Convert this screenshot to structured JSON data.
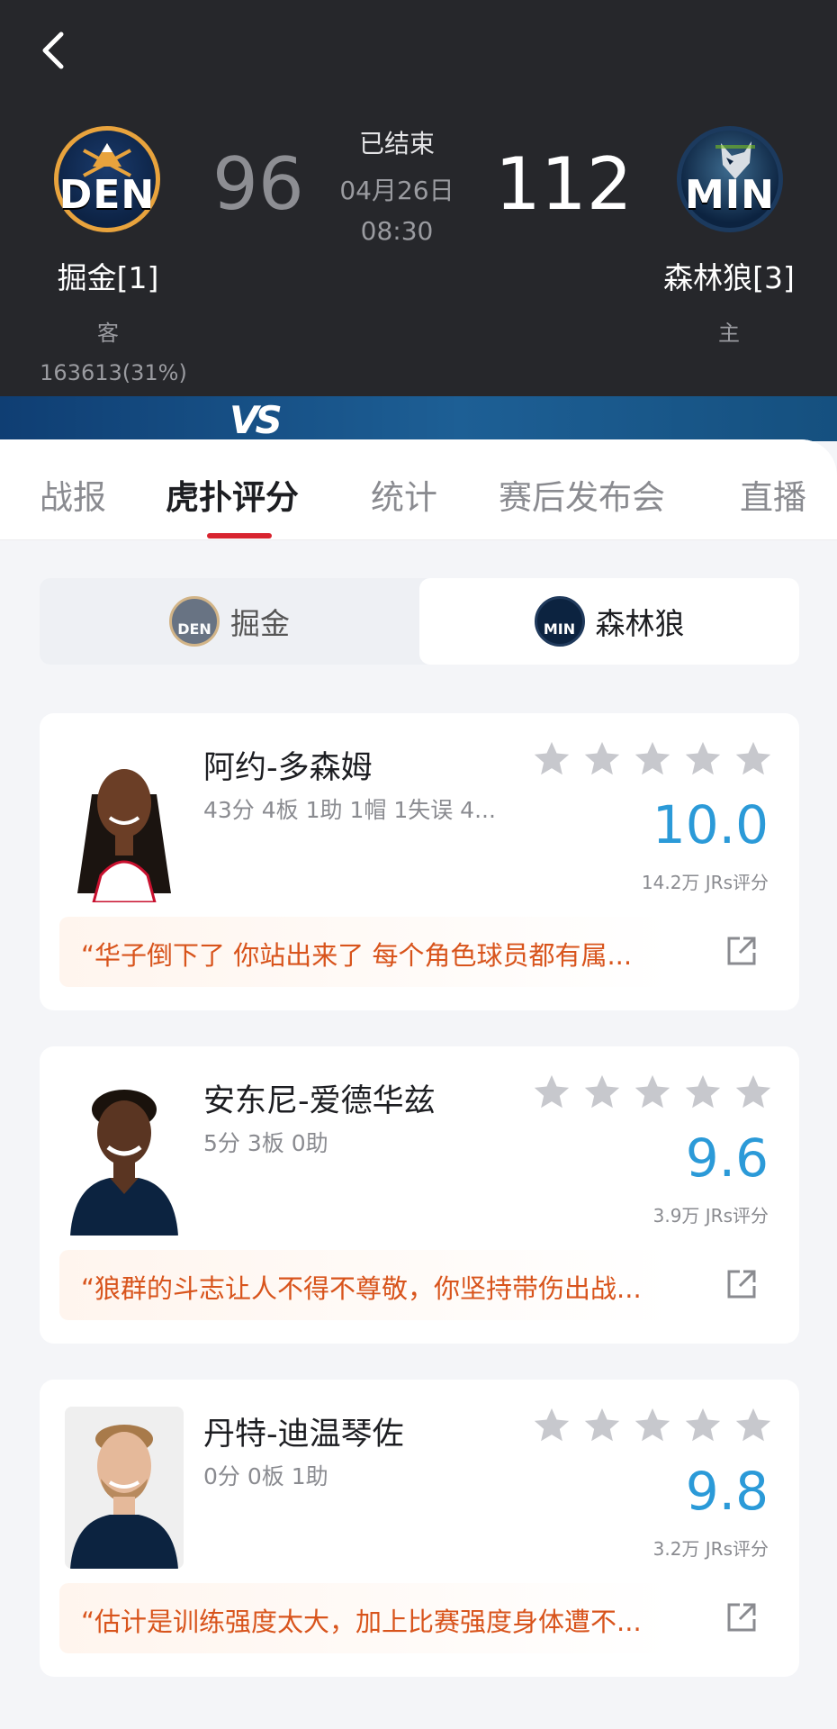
{
  "header": {
    "away": {
      "abbr": "DEN",
      "name": "掘金[1]",
      "role": "客",
      "support": "163613(31%)",
      "score": "96"
    },
    "home": {
      "abbr": "MIN",
      "name": "森林狼[3]",
      "role": "主",
      "score": "112"
    },
    "status": "已结束",
    "date": "04月26日",
    "time": "08:30",
    "vs_label": "VS",
    "icons": {
      "back": "chevron-left-icon"
    }
  },
  "tabs": [
    {
      "label": "战报",
      "active": false
    },
    {
      "label": "虎扑评分",
      "active": true
    },
    {
      "label": "统计",
      "active": false
    },
    {
      "label": "赛后发布会",
      "active": false
    },
    {
      "label": "直播",
      "active": false
    }
  ],
  "team_switch": {
    "left": {
      "abbr": "DEN",
      "label": "掘金",
      "selected": false
    },
    "right": {
      "abbr": "MIN",
      "label": "森林狼",
      "selected": true
    }
  },
  "players": [
    {
      "name": "阿约-多森姆",
      "stats": "43分 4板 1助 1帽 1失误 4...",
      "rating": "10.0",
      "votes": "14.2万 JRs评分",
      "stars": 5,
      "quote": "“华子倒下了 你站出来了 每个角色球员都有属..."
    },
    {
      "name": "安东尼-爱德华兹",
      "stats": "5分 3板 0助",
      "rating": "9.6",
      "votes": "3.9万 JRs评分",
      "stars": 5,
      "quote": "“狼群的斗志让人不得不尊敬，你坚持带伤出战..."
    },
    {
      "name": "丹特-迪温琴佐",
      "stats": "0分 0板 1助",
      "rating": "9.8",
      "votes": "3.2万 JRs评分",
      "stars": 5,
      "quote": "“估计是训练强度太大，加上比赛强度身体遭不..."
    }
  ],
  "colors": {
    "header_bg": "#26272b",
    "accent_red": "#d8242f",
    "rating_blue": "#2b9ad8",
    "quote_orange": "#d8541c",
    "star_gray": "#c7c8cd"
  }
}
